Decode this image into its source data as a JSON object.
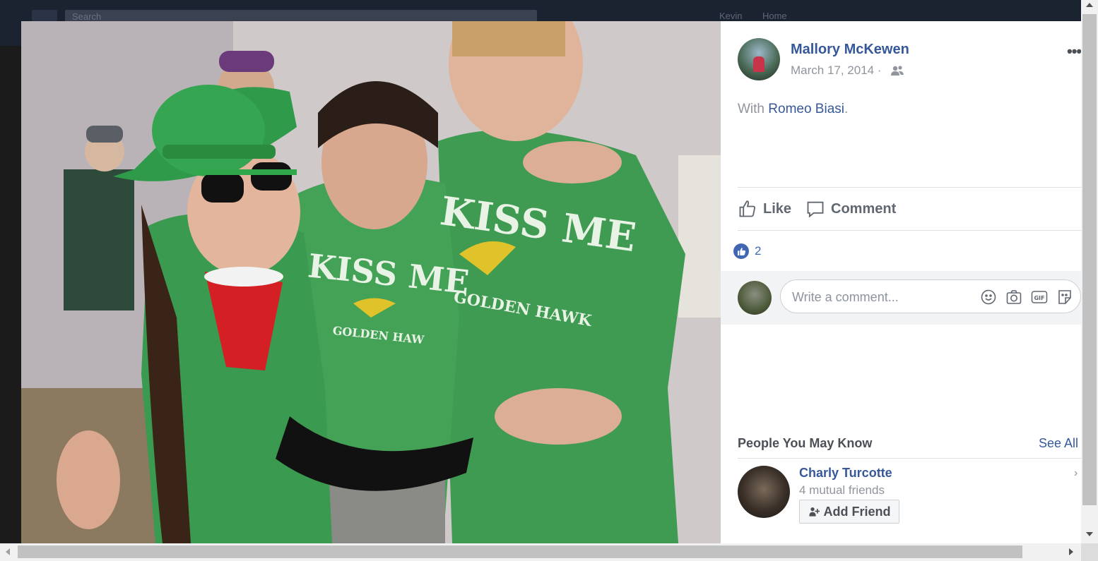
{
  "background": {
    "search_placeholder": "Search",
    "user_items": [
      "Kevin",
      "Home"
    ]
  },
  "photo": {
    "description_icon": "party-photo",
    "shirt_text_1": "KISS ME",
    "shirt_text_2": "KISS ME",
    "shirt_sub_1": "GOLDEN HAWK",
    "shirt_sub_2": "GOLDEN HAW"
  },
  "post": {
    "author": "Mallory McKewen",
    "date": "March 17, 2014 ·",
    "audience_icon": "friends-icon",
    "more_label": "•••",
    "caption_prefix": "With ",
    "tagged_person": "Romeo Biasi",
    "caption_suffix": "."
  },
  "actions": {
    "like_label": "Like",
    "comment_label": "Comment"
  },
  "reactions": {
    "count": "2"
  },
  "comment_box": {
    "placeholder": "Write a comment..."
  },
  "pymk": {
    "title": "People You May Know",
    "see_all": "See All",
    "person_name": "Charly Turcotte",
    "mutual": "4 mutual friends",
    "add_friend_label": "Add Friend"
  },
  "colors": {
    "link_blue": "#365899",
    "like_blue": "#4267b2",
    "muted_gray": "#90949c"
  }
}
